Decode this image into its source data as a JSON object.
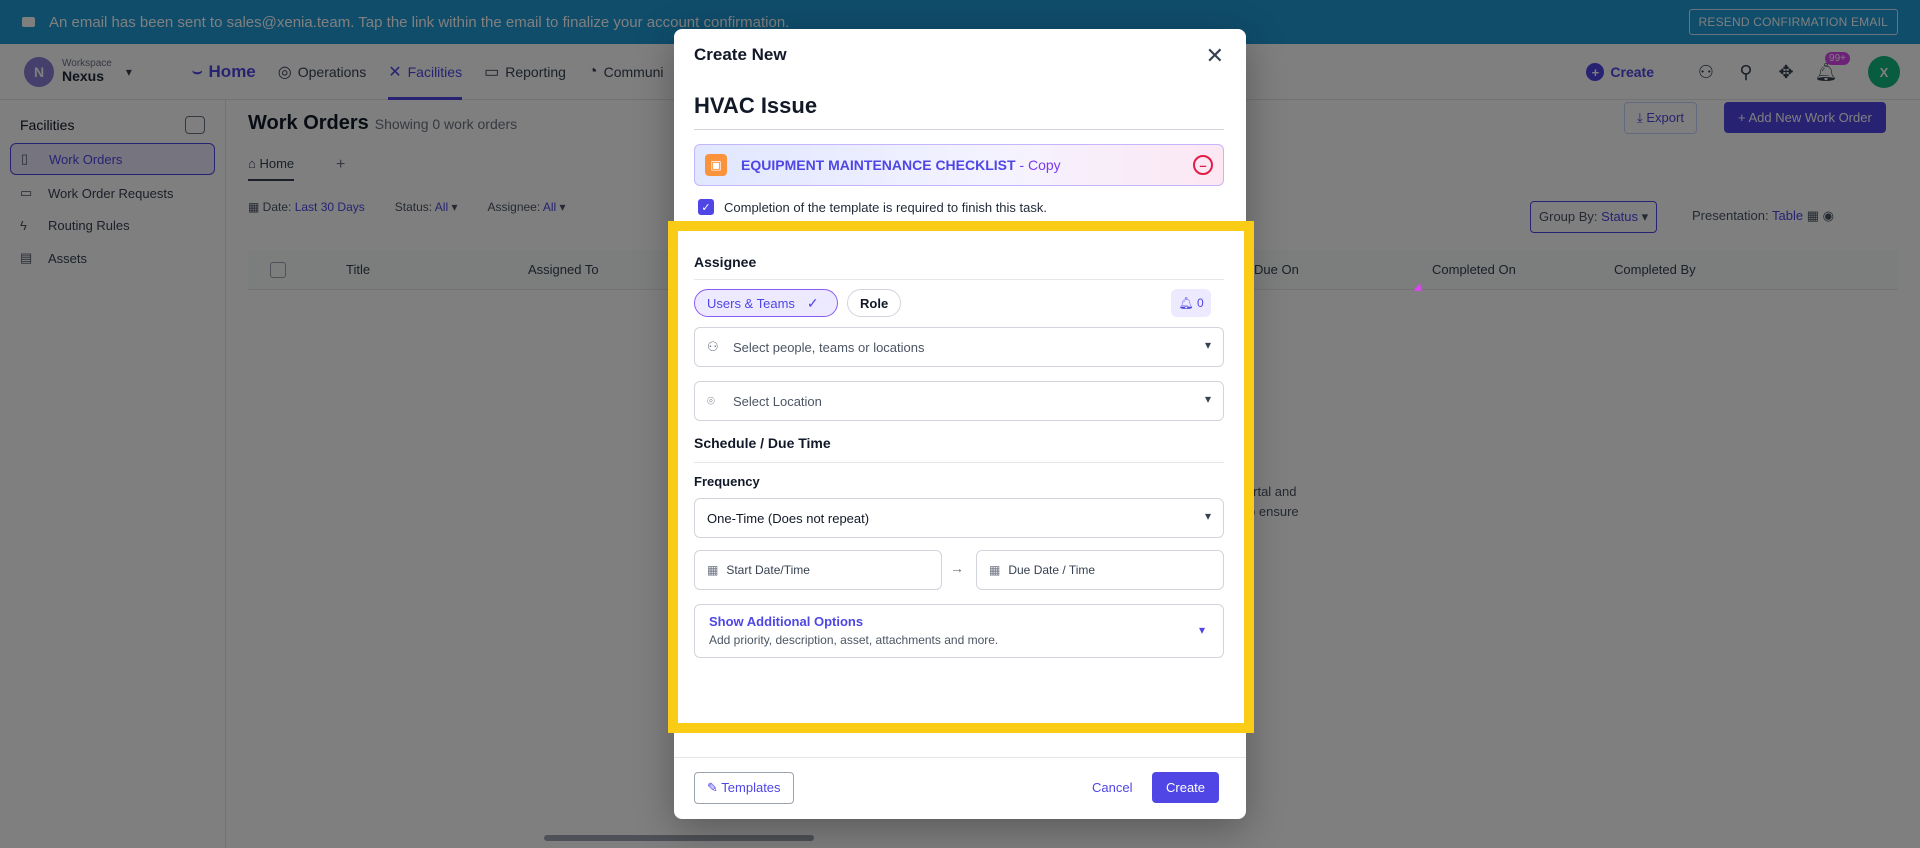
{
  "banner": {
    "message": "An email has been sent to sales@xenia.team. Tap the link within the email to finalize your account confirmation.",
    "resend_label": "RESEND CONFIRMATION EMAIL"
  },
  "workspace": {
    "caption": "Workspace",
    "name": "Nexus",
    "initial": "N"
  },
  "nav": {
    "home": "Home",
    "items": [
      "Operations",
      "Facilities",
      "Reporting",
      "Communi"
    ],
    "create_label": "Create",
    "notif_badge": "99+",
    "user_initial": "X"
  },
  "sidebar": {
    "title": "Facilities",
    "items": [
      {
        "label": "Work Orders",
        "icon": "document-icon"
      },
      {
        "label": "Work Order Requests",
        "icon": "inbox-icon"
      },
      {
        "label": "Routing Rules",
        "icon": "bolt-icon"
      },
      {
        "label": "Assets",
        "icon": "assets-icon"
      }
    ]
  },
  "main": {
    "title": "Work Orders",
    "subtitle": "Showing 0 work orders",
    "home_tab": "Home",
    "export_label": "Export",
    "add_label": "Add New Work Order",
    "filters": {
      "date_label": "Date:",
      "date_value": "Last 30 Days",
      "status_label": "Status:",
      "status_value": "All",
      "assignee_label": "Assignee:",
      "assignee_value": "All"
    },
    "group_by_label": "Group By:",
    "group_by_value": "Status",
    "presentation_label": "Presentation:",
    "presentation_value": "Table",
    "columns": [
      "Title",
      "Assigned To",
      "Due On",
      "Completed On",
      "Completed By"
    ],
    "empty_line1": "t Portal and",
    "empty_line2": "rs to ensure"
  },
  "modal": {
    "header": "Create New",
    "task_title": "HVAC Issue",
    "template_name": "EQUIPMENT MAINTENANCE CHECKLIST",
    "template_suffix": " - Copy",
    "required_text": "Completion of the template is required to finish this task.",
    "assignee_section": "Assignee",
    "users_teams_label": "Users & Teams",
    "role_label": "Role",
    "notify_count": "0",
    "people_placeholder": "Select people, teams or locations",
    "location_placeholder": "Select Location",
    "schedule_section": "Schedule / Due Time",
    "frequency_label": "Frequency",
    "frequency_value": "One-Time (Does not repeat)",
    "start_placeholder": "Start Date/Time",
    "due_placeholder": "Due Date / Time",
    "additional_title": "Show Additional Options",
    "additional_sub": "Add priority, description, asset, attachments and more.",
    "templates_label": "Templates",
    "cancel_label": "Cancel",
    "create_label": "Create"
  },
  "colors": {
    "accent": "#4f46e5",
    "banner": "#1f9ad6",
    "highlight": "#facc15"
  }
}
